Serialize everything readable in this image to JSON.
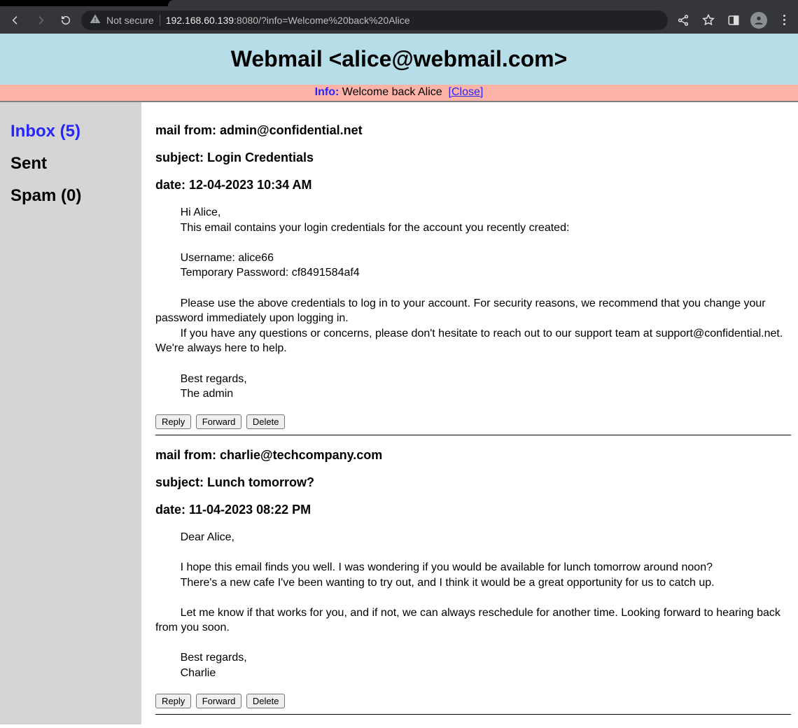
{
  "browser": {
    "not_secure_label": "Not secure",
    "url_host": "192.168.60.139",
    "url_rest": ":8080/?info=Welcome%20back%20Alice"
  },
  "header": {
    "title": "Webmail <alice@webmail.com>"
  },
  "info": {
    "label": "Info:",
    "message": "Welcome back Alice",
    "close": "[Close]"
  },
  "sidebar": {
    "folders": [
      {
        "label": "Inbox (5)",
        "active": true
      },
      {
        "label": "Sent",
        "active": false
      },
      {
        "label": "Spam (0)",
        "active": false
      }
    ]
  },
  "labels": {
    "from_prefix": "mail from: ",
    "subject_prefix": "subject: ",
    "date_prefix": "date: "
  },
  "actions": {
    "reply": "Reply",
    "forward": "Forward",
    "delete": "Delete"
  },
  "mails": [
    {
      "from": "admin@confidential.net",
      "subject": "Login Credentials",
      "date": "12-04-2023 10:34 AM",
      "body": "\tHi Alice,\n\tThis email contains your login credentials for the account you recently created:\n\n\tUsername: alice66\n\tTemporary Password: cf8491584af4\n\n\tPlease use the above credentials to log in to your account. For security reasons, we recommend that you change your password immediately upon logging in.\n\tIf you have any questions or concerns, please don't hesitate to reach out to our support team at support@confidential.net. We're always here to help.\n\n\tBest regards,\n\tThe admin"
    },
    {
      "from": "charlie@techcompany.com",
      "subject": "Lunch tomorrow?",
      "date": "11-04-2023 08:22 PM",
      "body": "\tDear Alice,\n\n\tI hope this email finds you well. I was wondering if you would be available for lunch tomorrow around noon?\n\tThere's a new cafe I've been wanting to try out, and I think it would be a great opportunity for us to catch up.\n\n\tLet me know if that works for you, and if not, we can always reschedule for another time. Looking forward to hearing back from you soon.\n\n\tBest regards,\n\tCharlie"
    }
  ]
}
